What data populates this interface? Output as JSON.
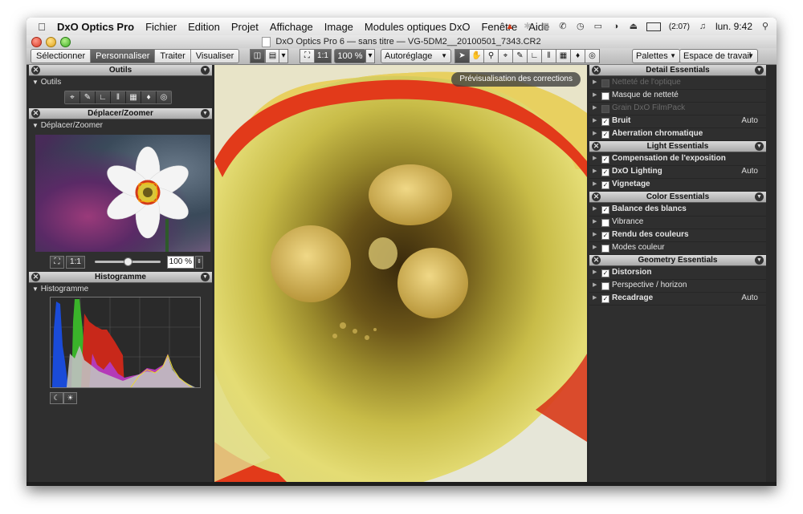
{
  "menubar": {
    "app": "DxO Optics Pro",
    "items": [
      "Fichier",
      "Edition",
      "Projet",
      "Affichage",
      "Image",
      "Modules optiques DxO",
      "Fenêtre",
      "Aide"
    ],
    "battery": "(2:07)",
    "clock": "lun. 9:42"
  },
  "window": {
    "title": "DxO Optics Pro 6 — sans titre — VG-5DM2__20100501_7343.CR2"
  },
  "toolbar": {
    "tabs": [
      "Sélectionner",
      "Personnaliser",
      "Traiter",
      "Visualiser"
    ],
    "active_tab": "Personnaliser",
    "ratio_label": "1:1",
    "zoom_value": "100 %",
    "autoreglage": "Autoréglage",
    "palettes": "Palettes",
    "workspace": "Espace de travail"
  },
  "left": {
    "tools_header": "Outils",
    "tools_sub": "Outils",
    "move_header": "Déplacer/Zoomer",
    "move_sub": "Déplacer/Zoomer",
    "zoom_ratio": "1:1",
    "zoom_value": "100 %",
    "zoom_level": 0.5,
    "histo_header": "Histogramme",
    "histo_sub": "Histogramme"
  },
  "viewer": {
    "preview_label": "Prévisualisation des corrections"
  },
  "right": {
    "sections": [
      {
        "title": "Detail Essentials",
        "items": [
          {
            "label": "Netteté de l'optique",
            "checked": false,
            "enabled": false,
            "bold": false,
            "value": ""
          },
          {
            "label": "Masque de netteté",
            "checked": false,
            "enabled": true,
            "bold": false,
            "value": ""
          },
          {
            "label": "Grain DxO FilmPack",
            "checked": false,
            "enabled": false,
            "bold": false,
            "value": ""
          },
          {
            "label": "Bruit",
            "checked": true,
            "enabled": true,
            "bold": true,
            "value": "Auto"
          },
          {
            "label": "Aberration chromatique",
            "checked": true,
            "enabled": true,
            "bold": true,
            "value": ""
          }
        ]
      },
      {
        "title": "Light Essentials",
        "items": [
          {
            "label": "Compensation de l'exposition",
            "checked": true,
            "enabled": true,
            "bold": true,
            "value": ""
          },
          {
            "label": "DxO Lighting",
            "checked": true,
            "enabled": true,
            "bold": true,
            "value": "Auto"
          },
          {
            "label": "Vignetage",
            "checked": true,
            "enabled": true,
            "bold": true,
            "value": ""
          }
        ]
      },
      {
        "title": "Color Essentials",
        "items": [
          {
            "label": "Balance des blancs",
            "checked": true,
            "enabled": true,
            "bold": true,
            "value": ""
          },
          {
            "label": "Vibrance",
            "checked": false,
            "enabled": true,
            "bold": false,
            "value": ""
          },
          {
            "label": "Rendu des couleurs",
            "checked": true,
            "enabled": true,
            "bold": true,
            "value": ""
          },
          {
            "label": "Modes couleur",
            "checked": false,
            "enabled": true,
            "bold": false,
            "value": ""
          }
        ]
      },
      {
        "title": "Geometry Essentials",
        "items": [
          {
            "label": "Distorsion",
            "checked": true,
            "enabled": true,
            "bold": true,
            "value": ""
          },
          {
            "label": "Perspective / horizon",
            "checked": false,
            "enabled": true,
            "bold": false,
            "value": ""
          },
          {
            "label": "Recadrage",
            "checked": true,
            "enabled": true,
            "bold": true,
            "value": "Auto"
          }
        ]
      }
    ]
  },
  "icons": {
    "apple": "apple-icon",
    "close": "close-icon",
    "dropdown": "chevron-down-icon"
  },
  "colors": {
    "panel_bg": "#2f2f2f",
    "panel_header": "#bdbdbd",
    "active_tab": "#555555",
    "flower_red": "#e23a1a",
    "flower_yellow": "#e8e070"
  }
}
